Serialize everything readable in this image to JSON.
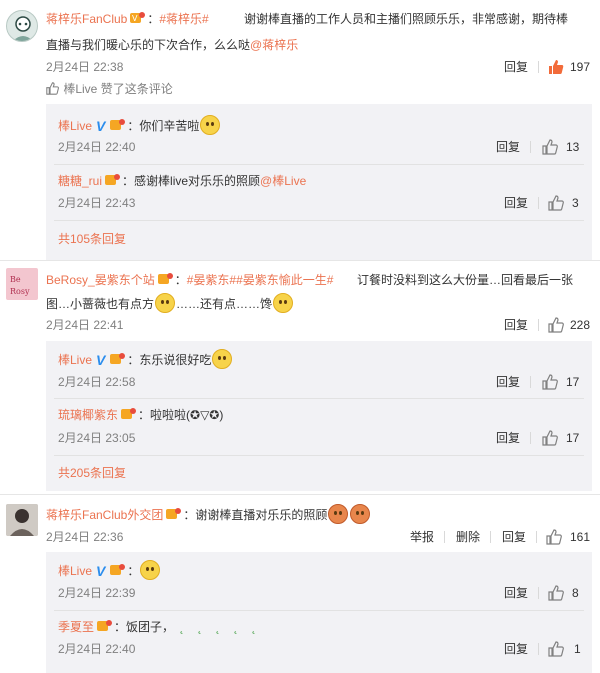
{
  "comments": [
    {
      "author": "蒋梓乐FanClub",
      "topic": "#蒋梓乐#",
      "text": "谢谢棒直播的工作人员和主播们照顾乐乐，非常感谢，期待棒直播与我们暖心乐的下次合作，么么哒",
      "mention": "@蒋梓乐",
      "time": "2月24日 22:38",
      "reply_label": "回复",
      "likes": "197",
      "liked_by": "棒Live 赞了这条评论",
      "replies": [
        {
          "author": "棒Live",
          "text": "你们辛苦啦",
          "time": "2月24日 22:40",
          "reply_label": "回复",
          "likes": "13"
        },
        {
          "author": "糖糖_rui",
          "text": "感谢棒live对乐乐的照顾",
          "mention": "@棒Live",
          "time": "2月24日 22:43",
          "reply_label": "回复",
          "likes": "3"
        }
      ],
      "more": "共105条回复"
    },
    {
      "author": "BeRosy_晏紫东个站",
      "avatar_text": "Be Rosy",
      "topic": "#晏紫东#",
      "topic2": "#晏紫东愉此一生#",
      "text1": "订餐时没料到这么大份量…回看最后一张",
      "text2a": "图…小蔷薇也有点方",
      "text2b": "……还有点……馋",
      "time": "2月24日 22:41",
      "reply_label": "回复",
      "likes": "228",
      "replies": [
        {
          "author": "棒Live",
          "text": "东乐说很好吃",
          "time": "2月24日 22:58",
          "reply_label": "回复",
          "likes": "17"
        },
        {
          "author": "琉璃椰紫东",
          "text": "啦啦啦(✪▽✪)",
          "time": "2月24日 23:05",
          "reply_label": "回复",
          "likes": "17"
        }
      ],
      "more": "共205条回复"
    },
    {
      "author": "蒋梓乐FanClub外交团",
      "text": "谢谢棒直播对乐乐的照顾",
      "time": "2月24日 22:36",
      "report_label": "举报",
      "delete_label": "删除",
      "reply_label": "回复",
      "likes": "161",
      "replies": [
        {
          "author": "棒Live",
          "text": "",
          "time": "2月24日 22:39",
          "reply_label": "回复",
          "likes": "8"
        },
        {
          "author": "季夏至",
          "text": "饭团子，",
          "time": "2月24日 22:40",
          "reply_label": "回复",
          "likes": "1"
        }
      ]
    }
  ],
  "icons": {
    "thumb": "thumbs-up-icon",
    "liked_thumb": "thumbs-up-liked-icon",
    "verified": "verified-v-icon"
  },
  "colors": {
    "name": "#eb7350",
    "liked": "#f26b3a",
    "verified": "#2b8ded",
    "reply_bg": "#f2f2f5"
  }
}
